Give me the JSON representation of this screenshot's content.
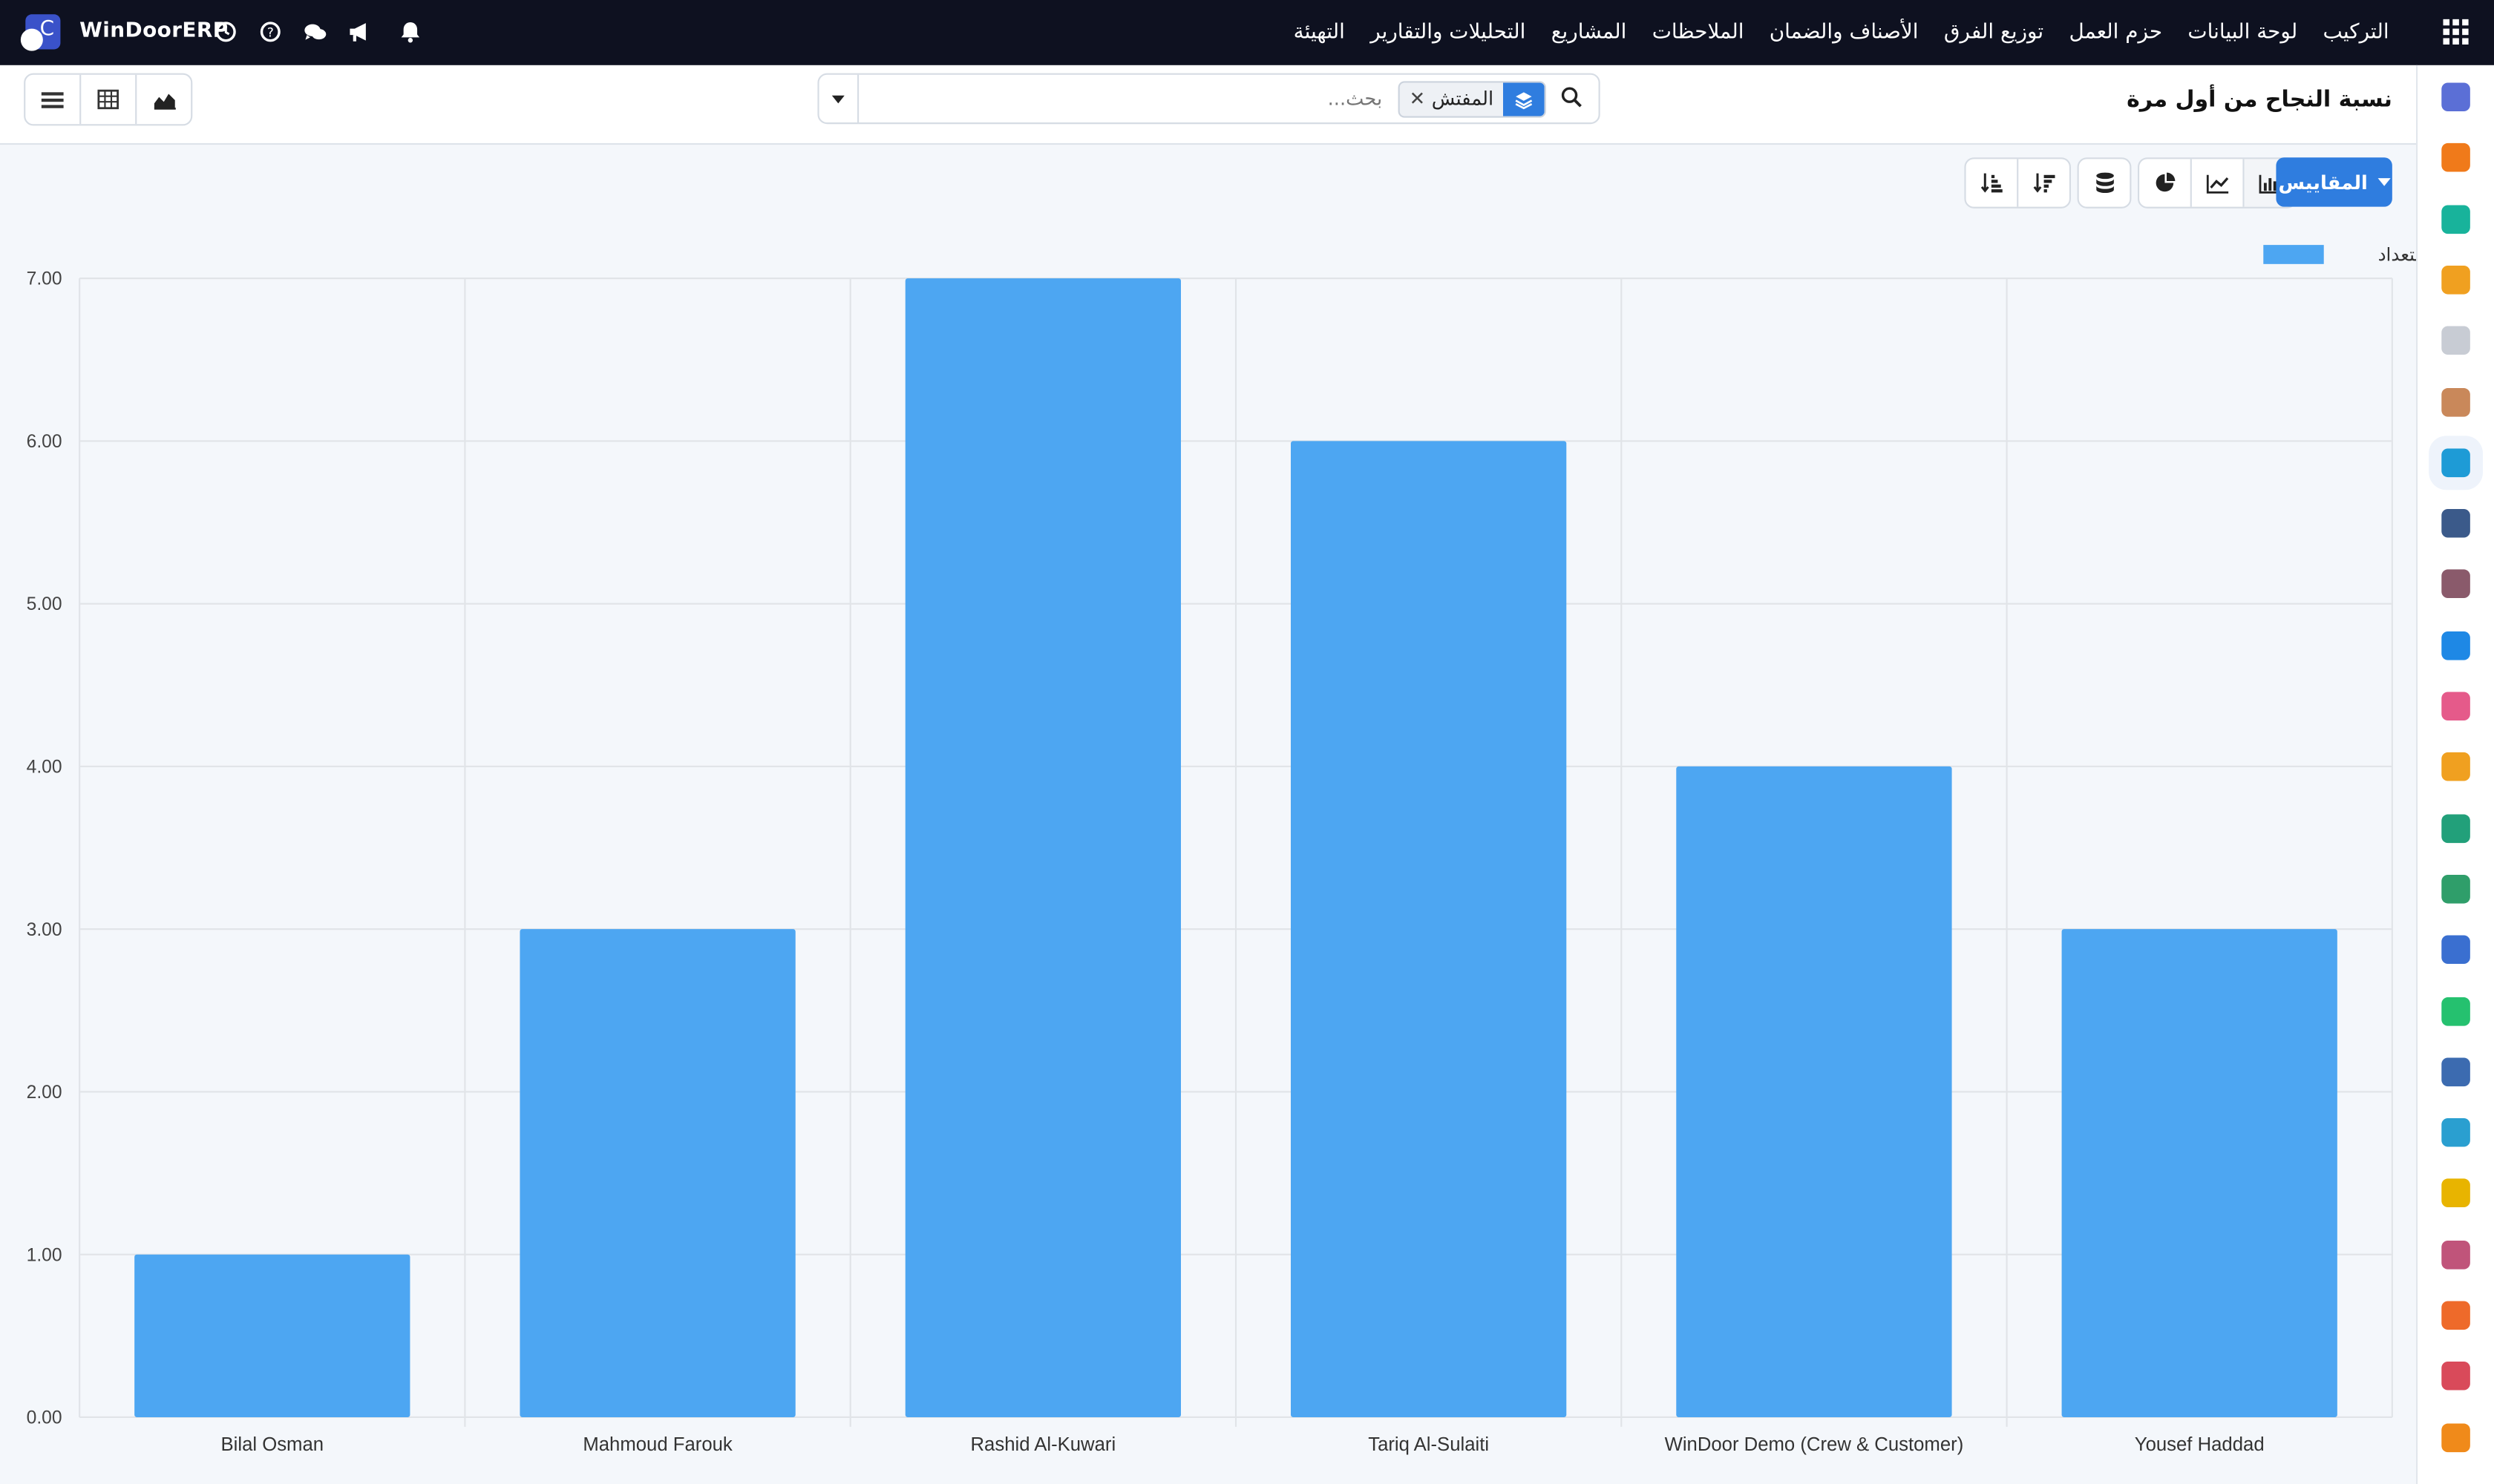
{
  "app": {
    "brand": "WinDoorERP",
    "logo_letter": "C"
  },
  "topbar": {
    "menu": [
      "التركيب",
      "لوحة البيانات",
      "حزم العمل",
      "توزيع الفرق",
      "الأصناف والضمان",
      "الملاحظات",
      "المشاريع",
      "التحليلات والتقارير",
      "التهيئة"
    ],
    "icons": [
      "clock-icon",
      "help-icon",
      "chat-icon",
      "megaphone-icon",
      "bell-icon"
    ]
  },
  "page": {
    "title": "نسبة النجاح من أول مرة"
  },
  "search": {
    "placeholder": "بحث...",
    "facet_label": "المفتش",
    "facet_icon": "layers-icon"
  },
  "toolbar": {
    "measures_label": "المقاييس"
  },
  "view_switcher": [
    "list-view-icon",
    "pivot-view-icon",
    "graph-view-icon"
  ],
  "colors": {
    "accent": "#2f7ddf",
    "bar": "#4da6f2",
    "topbar": "#0e1120"
  },
  "sidebar_apps": [
    "m-app-icon",
    "chat-bubble-app-icon",
    "check-app-icon",
    "bar-chart-app-icon",
    "cube-app-icon",
    "puzzle-app-icon",
    "todo-app-icon",
    "book-app-icon",
    "box-app-icon",
    "dollar-app-icon",
    "team-app-icon",
    "calendar-31-app-icon",
    "pen-app-icon",
    "contact-app-icon",
    "dashboard-app-icon",
    "whatsapp-app-icon",
    "compass-app-icon",
    "wave-app-icon",
    "send-app-icon",
    "card-app-icon",
    "hex-app-icon",
    "pie-app-icon",
    "honey-app-icon"
  ],
  "chart_data": {
    "type": "bar",
    "categories": [
      "Bilal Osman",
      "Mahmoud Farouk",
      "Rashid Al-Kuwari",
      "Tariq Al-Sulaiti",
      "WinDoor Demo (Crew & Customer)",
      "Yousef Haddad"
    ],
    "series": [
      {
        "name": "التعداد",
        "values": [
          1,
          3,
          7,
          6,
          4,
          3
        ]
      }
    ],
    "yticks": [
      "0.00",
      "1.00",
      "2.00",
      "3.00",
      "4.00",
      "5.00",
      "6.00",
      "7.00"
    ],
    "ylim": [
      0,
      7
    ],
    "grid": true,
    "legend": "top-right"
  }
}
